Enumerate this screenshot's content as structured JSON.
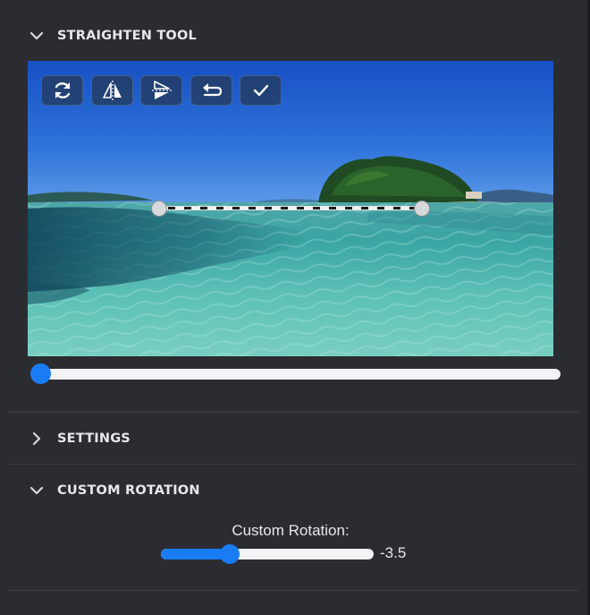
{
  "panel": {
    "sections": {
      "straighten": {
        "title": "STRAIGHTEN TOOL",
        "expanded": true
      },
      "settings": {
        "title": "SETTINGS",
        "expanded": false
      },
      "custom_rotation": {
        "title": "CUSTOM ROTATION",
        "expanded": true
      }
    }
  },
  "toolbar": {
    "buttons": [
      {
        "name": "rotate",
        "icon": "rotate-arrows-icon"
      },
      {
        "name": "flip-horizontal",
        "icon": "flip-horizontal-icon"
      },
      {
        "name": "flip-vertical",
        "icon": "flip-vertical-icon"
      },
      {
        "name": "undo",
        "icon": "undo-arrow-icon"
      },
      {
        "name": "apply",
        "icon": "checkmark-icon"
      }
    ]
  },
  "straighten_slider": {
    "value_fraction": 0.0
  },
  "custom_rotation": {
    "label": "Custom Rotation:",
    "value": "-3.5",
    "min": -10,
    "max": 10,
    "numeric_value": -3.5
  },
  "colors": {
    "accent": "#1a7cf5",
    "panel_bg": "#2a2c31",
    "divider": "#3d3f45"
  }
}
